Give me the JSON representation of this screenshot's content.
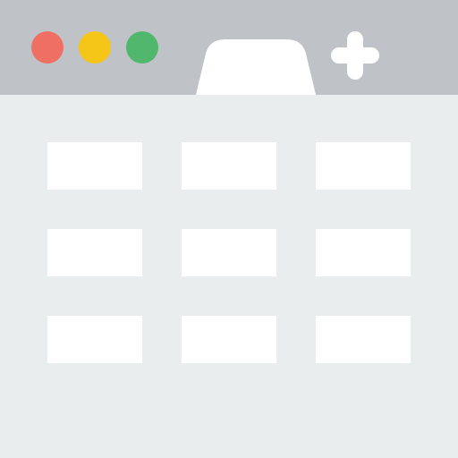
{
  "colors": {
    "titlebar": "#bfc3c7",
    "content_bg": "#e9edee",
    "tab": "#ffffff",
    "tile": "#ffffff",
    "close_dot": "#ef6f62",
    "minimize_dot": "#f5c518",
    "maximize_dot": "#51b76c"
  },
  "window_controls": [
    "close-dot",
    "minimize-dot",
    "maximize-dot"
  ],
  "toolbar": {
    "new_tab_icon": "plus-icon"
  },
  "grid": {
    "rows": 3,
    "columns": 3
  }
}
